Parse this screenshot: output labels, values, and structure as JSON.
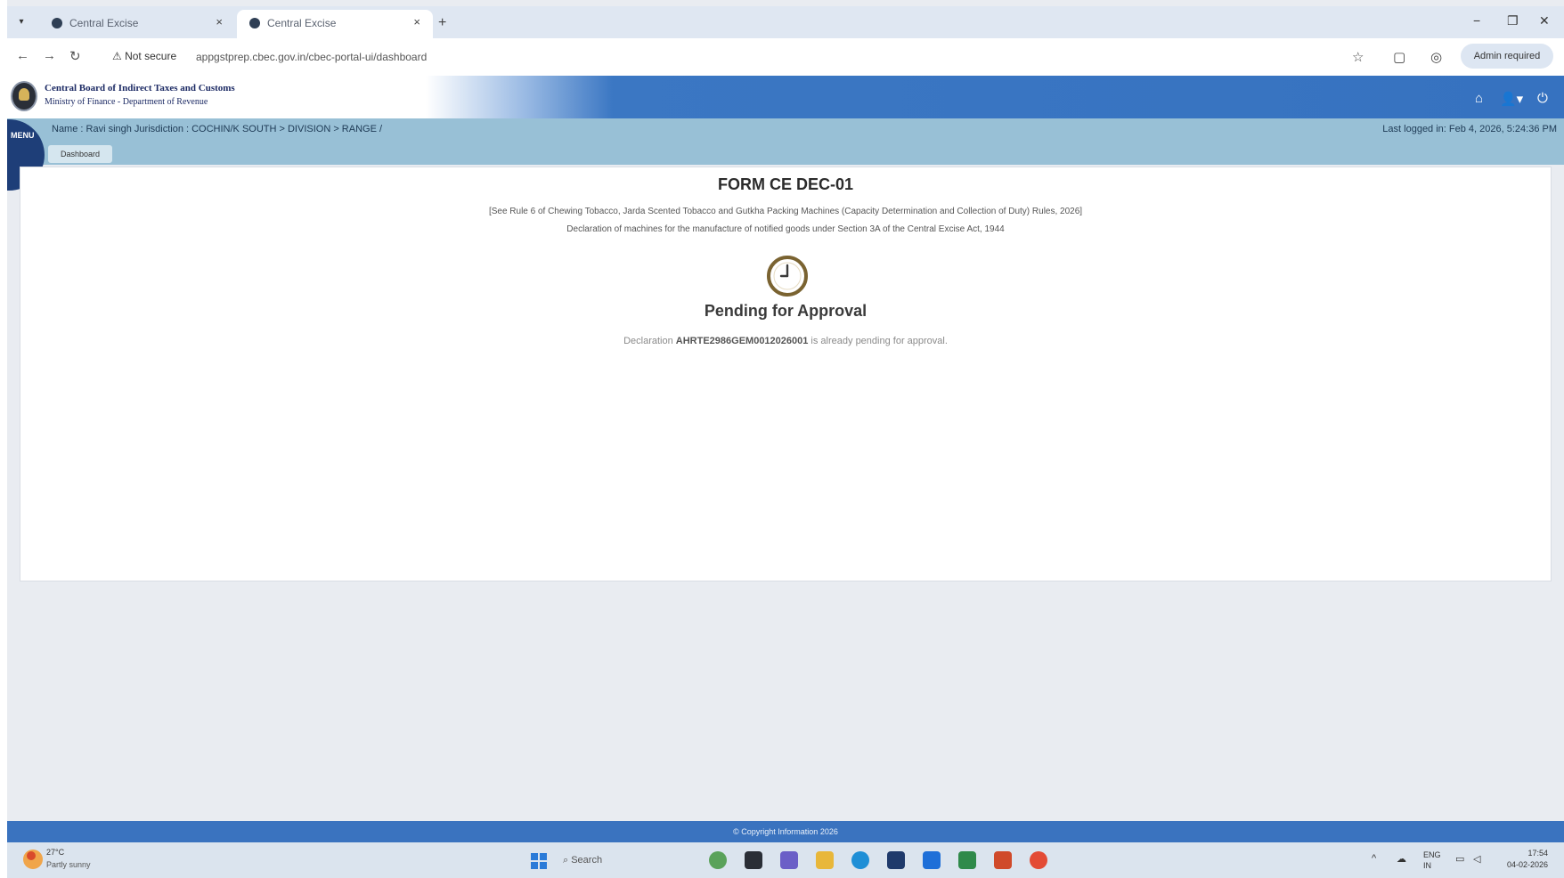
{
  "browser": {
    "tabs": [
      {
        "title": "Central Excise",
        "active": false
      },
      {
        "title": "Central Excise",
        "active": true
      }
    ],
    "address": {
      "security_label": "Not secure",
      "url": "appgstprep.cbec.gov.in/cbec-portal-ui/dashboard"
    },
    "admin_pill": "Admin required"
  },
  "header": {
    "org_title": "Central Board of Indirect Taxes and Customs",
    "org_subtitle": "Ministry of Finance - Department of Revenue"
  },
  "info_bar": {
    "user_info": "Name : Ravi singh   Jurisdiction : COCHIN/K SOUTH > DIVISION > RANGE /",
    "last_login": "Last logged in: Feb 4, 2026, 5:24:36 PM",
    "breadcrumb": "Dashboard"
  },
  "side_menu": {
    "label": "MENU"
  },
  "form": {
    "title": "FORM CE DEC-01",
    "rule_line": "[See Rule 6 of Chewing Tobacco, Jarda Scented Tobacco and Gutkha Packing Machines (Capacity Determination and Collection of Duty) Rules, 2026]",
    "declaration_line": "Declaration of machines for the manufacture of notified goods under Section 3A of the Central Excise Act, 1944",
    "status_heading": "Pending for Approval",
    "status_prefix": "Declaration ",
    "declaration_id": "AHRTE2986GEM0012026001",
    "status_suffix": " is already pending for approval."
  },
  "footer": {
    "text": "© Copyright Information 2026"
  },
  "taskbar": {
    "weather_temp": "27°C",
    "weather_desc": "Partly sunny",
    "search_placeholder": "Search",
    "lang_1": "ENG",
    "lang_2": "IN",
    "time": "17:54",
    "date": "04-02-2026"
  },
  "colors": {
    "header_blue": "#3672c0",
    "info_bar": "#98c0d6",
    "menu_tab": "#1e3e78",
    "clock_ring": "#7a6331"
  }
}
